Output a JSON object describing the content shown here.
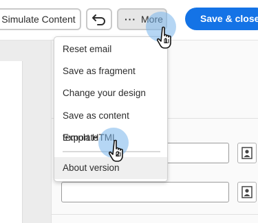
{
  "toolbar": {
    "simulate_label": "Simulate Content",
    "more_dots": "···",
    "more_label": "More",
    "save_label": "Save & close"
  },
  "more_menu": {
    "items": [
      {
        "label": "Reset email"
      },
      {
        "label": "Save as fragment"
      },
      {
        "label": "Change your design"
      },
      {
        "label": "Save as content template"
      },
      {
        "label": "Export HTML"
      },
      {
        "label": "About version"
      }
    ]
  },
  "cursors": [
    {
      "step": "1"
    },
    {
      "step": "2"
    }
  ],
  "colors": {
    "primary": "#1473e6",
    "highlight_halo": "#78b4eb"
  }
}
